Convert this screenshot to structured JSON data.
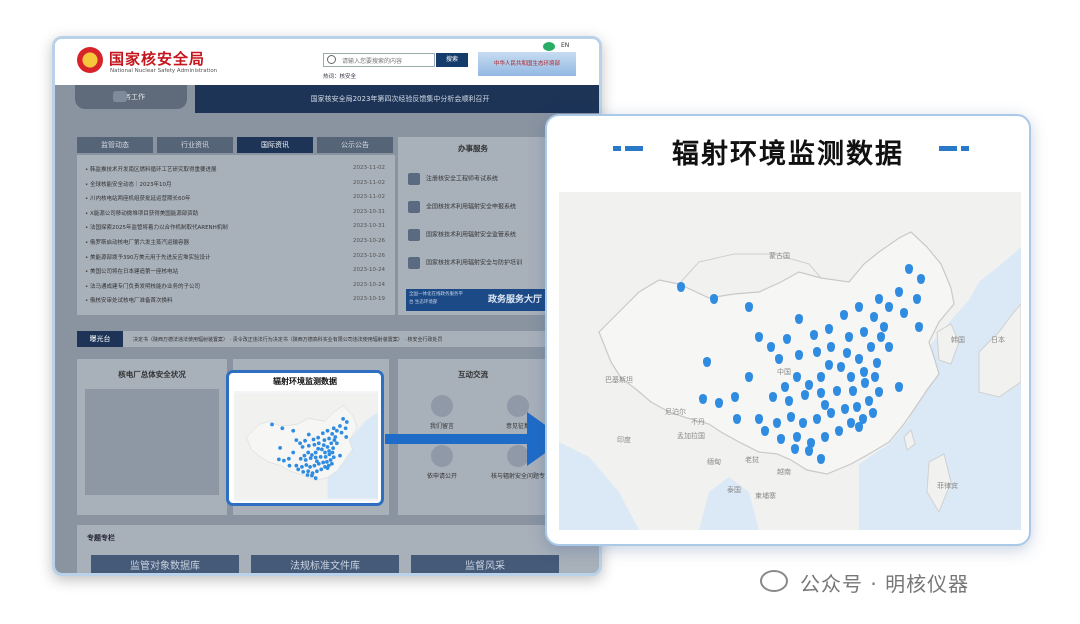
{
  "site": {
    "title": "国家核安全局",
    "subtitle": "National Nuclear Safety Administration",
    "search_placeholder": "请输入您要搜索的内容",
    "search_button": "搜索",
    "hot_label": "热词：",
    "hot_word": "核安全",
    "gov_badge": "中华人民共和国生态环境部",
    "lang": "EN",
    "nav_work": "业务工作",
    "banner": "国家核安全局2023年第四次经验反馈集中分析会顺利召开",
    "tabs": [
      "监管动态",
      "行业资讯",
      "国际资讯",
      "公示公告"
    ],
    "active_tab": "国际资讯",
    "news": [
      {
        "title": "韩监推技术开发南区燃料循环工艺研究取得重要进展",
        "date": "2023-11-02"
      },
      {
        "title": "全球核能安全动态｜2023年10月",
        "date": "2023-11-02"
      },
      {
        "title": "川内核电站两座机组获批延运营期长60年",
        "date": "2023-11-02"
      },
      {
        "title": "X能源公司移动微堆项目获得美国能源部资助",
        "date": "2023-10-31"
      },
      {
        "title": "法国探索2025年监管将着力以合作机制取代ARENH机制",
        "date": "2023-10-31"
      },
      {
        "title": "俄罗斯启动核电厂第六发主蒸汽运输容器",
        "date": "2023-10-26"
      },
      {
        "title": "美能源部拨予390万美元用于先进反应堆实验设计",
        "date": "2023-10-26"
      },
      {
        "title": "美国公司将在日本建造第一座核电站",
        "date": "2023-10-24"
      },
      {
        "title": "法马通成建专门负责发明核能办业务的子公司",
        "date": "2023-10-24"
      },
      {
        "title": "俄核安审处试核电厂准备首次换料",
        "date": "2023-10-19"
      }
    ],
    "service": {
      "title": "办事服务",
      "items": [
        "注册核安全工程师考试系统",
        "全国核技术利用辐射安全申报系统",
        "国家核技术利用辐射安全监管系统",
        "国家核技术利用辐射安全与防护培训"
      ],
      "hall_label": "政务服务大厅",
      "hall_sub": "全国一体化在线政务服务平台 生态环境部"
    },
    "bgt_label": "曝光台",
    "bgt_text": "决定书（陕西万德法违法使用辐射装置案）  ·  责令改正违法行为决定书（陕西万德高科实业有限公司违法使用辐射装置案）  ·  核安全行政处罚",
    "safety_title": "核电厂总体安全状况",
    "interact_title": "互动交流",
    "interact_items": [
      "我们留言",
      "意见征集",
      "依申请公开",
      "核与辐射安全问题专"
    ],
    "zt_title": "专题专栏",
    "zt_cards": [
      "监管对象数据库",
      "法规标准文件库",
      "监督风采"
    ]
  },
  "small_card": {
    "title": "辐射环境监测数据"
  },
  "big_card": {
    "title": "辐射环境监测数据",
    "map_labels": [
      "中国",
      "蒙古国",
      "日本",
      "韩国",
      "巴基斯坦",
      "印度",
      "孟加拉国",
      "缅甸",
      "泰国",
      "越南",
      "老挝",
      "柬埔寨",
      "菲律宾",
      "尼泊尔",
      "不丹"
    ],
    "marker_color": "#2f8ce0"
  },
  "watermark": "公众号 · 明核仪器"
}
